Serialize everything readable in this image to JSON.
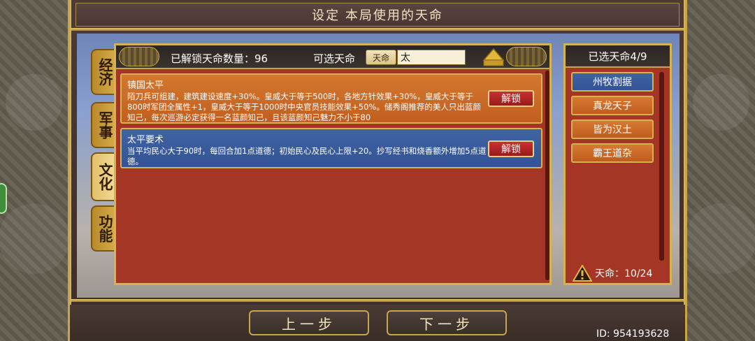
{
  "title": "设定 本局使用的天命",
  "tabs": [
    {
      "label": "经济",
      "active": false
    },
    {
      "label": "军事",
      "active": false
    },
    {
      "label": "文化",
      "active": true
    },
    {
      "label": "功能",
      "active": false
    }
  ],
  "header": {
    "unlocked_count": "已解锁天命数量：96",
    "available_label": "可选天命",
    "filter_tag": "天命",
    "search_value": "太"
  },
  "items": [
    {
      "title": "镇国太平",
      "description": "陌刀兵可组建，建筑建设速度+30%。皇威大于等于500时，各地方针效果+30%，皇威大于等于800时军团全属性+1，皇威大于等于1000时中央官员技能效果+50%。储秀阁推荐的美人只出蓝颜知己，每次巡游必定获得一名蓝颜知己，且该蓝颜知己魅力不小于80",
      "button": "解锁"
    },
    {
      "title": "太平要术",
      "description": "当平均民心大于90时，每回合加1点道德；初始民心及民心上限+20。抄写经书和烧香额外增加5点道德。",
      "button": "解锁"
    }
  ],
  "selected": {
    "header": "已选天命4/9",
    "items": [
      {
        "label": "州牧割据",
        "active": true
      },
      {
        "label": "真龙天子",
        "active": false
      },
      {
        "label": "皆为汉土",
        "active": false
      },
      {
        "label": "霸王道杂",
        "active": false
      }
    ],
    "mandate_count": "天命：10/24"
  },
  "nav": {
    "prev": "上一步",
    "next": "下一步"
  },
  "id_label": "ID: 954193628",
  "colors": {
    "panel_red": "#a53525",
    "card_orange": "#c86a28",
    "card_blue": "#3a5c9c",
    "gold": "#d6b352"
  }
}
